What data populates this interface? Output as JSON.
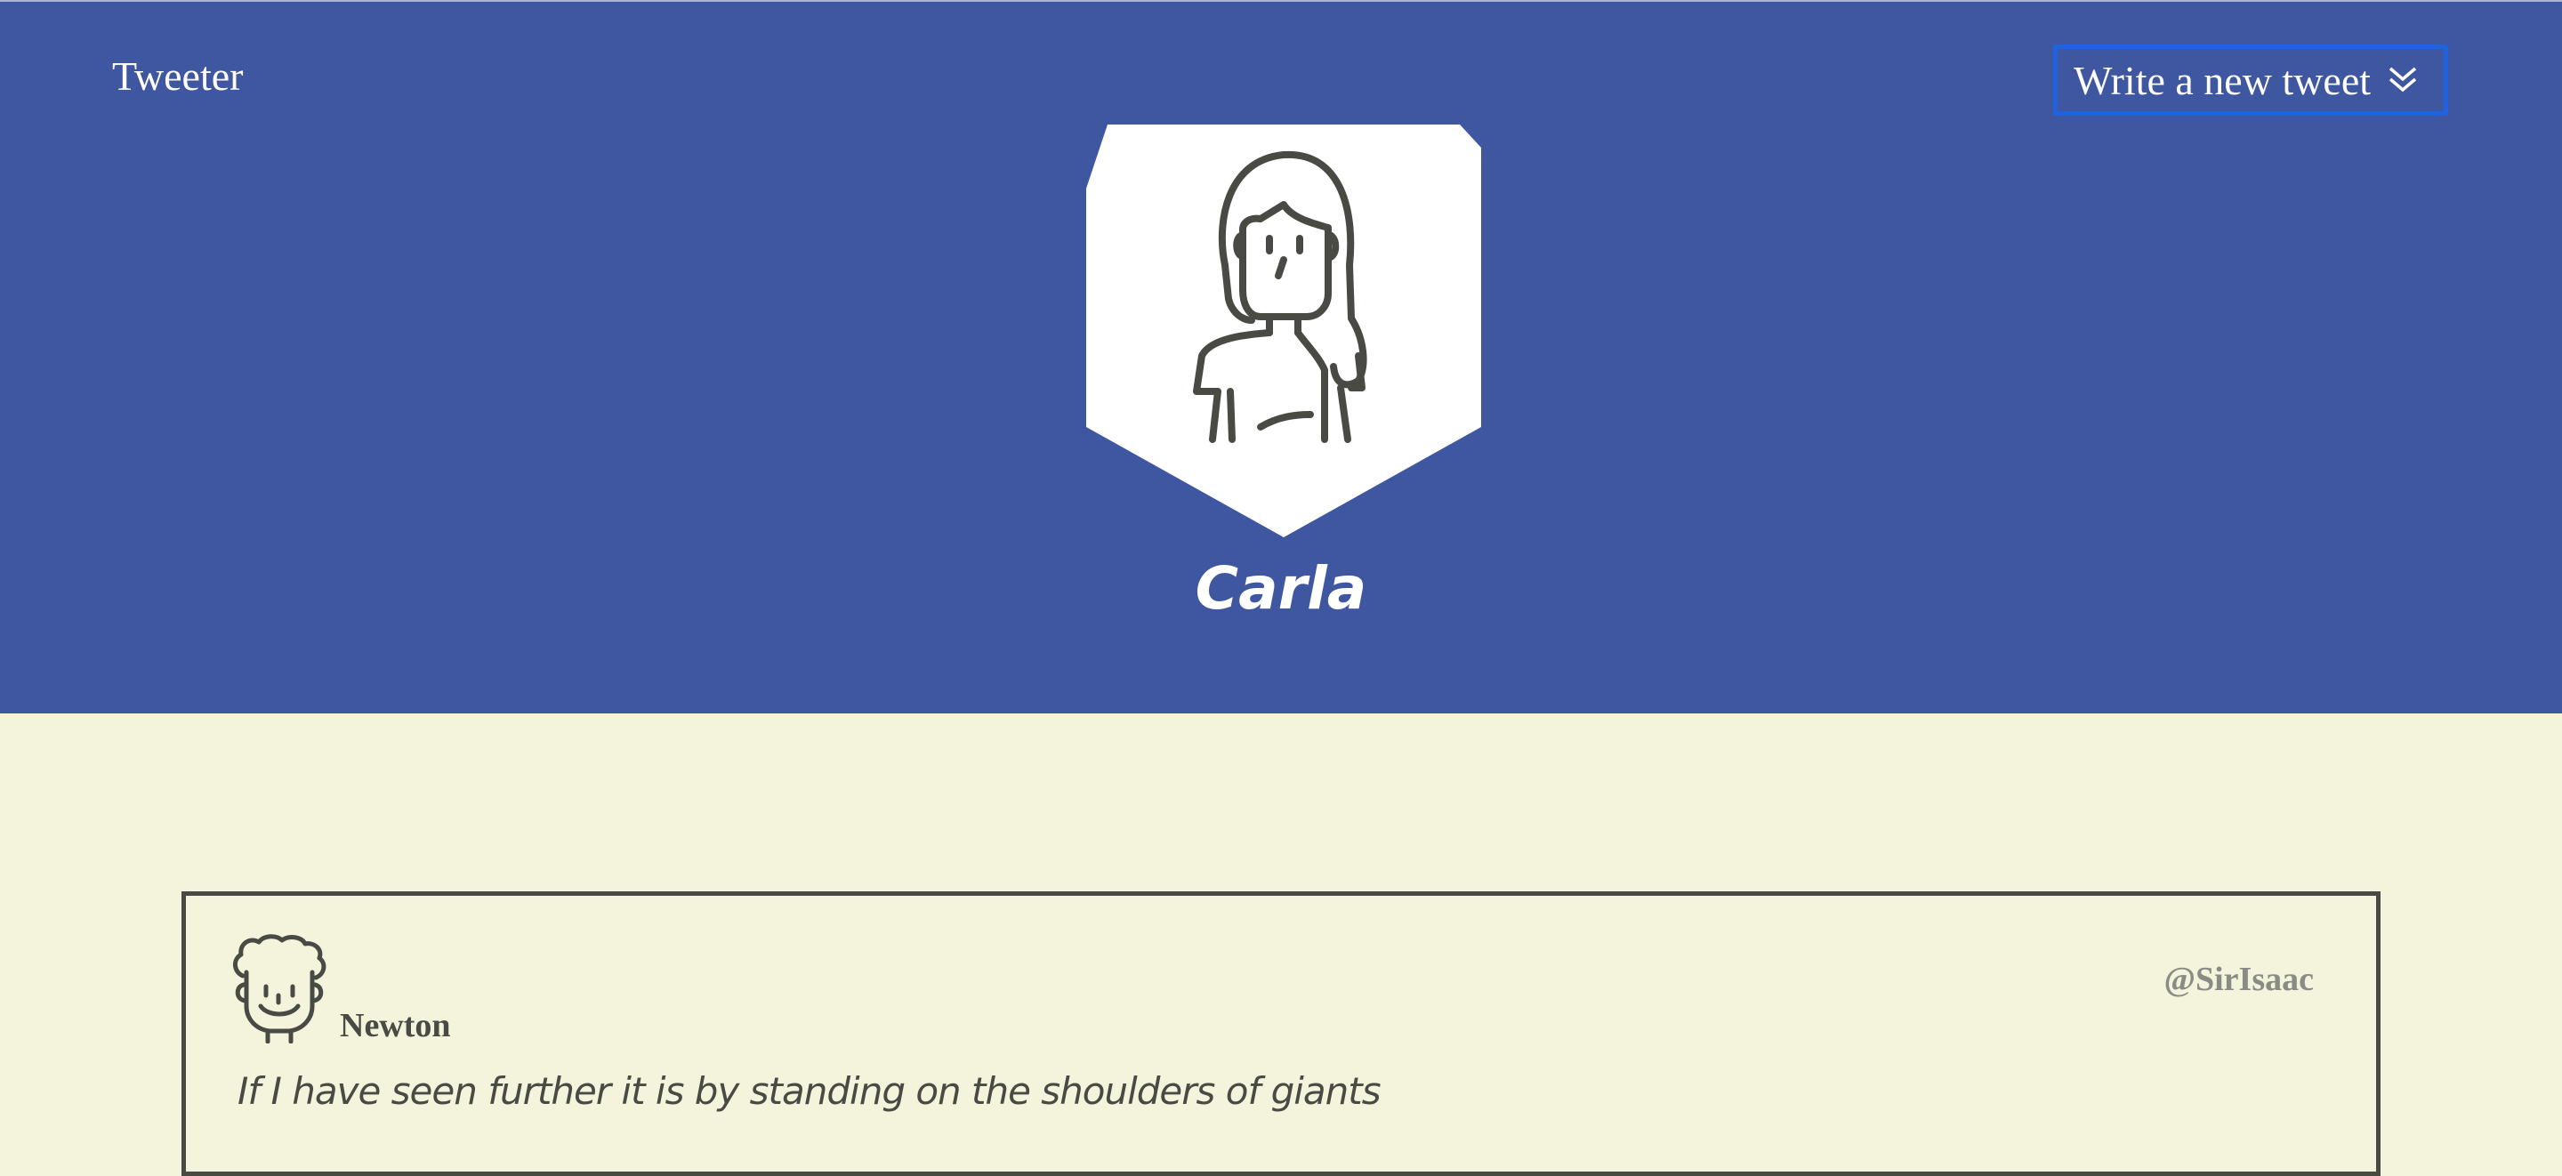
{
  "nav": {
    "brand": "Tweeter",
    "compose_label": "Write a new tweet",
    "compose_icon": "double-chevron-down-icon"
  },
  "profile": {
    "name": "Carla",
    "avatar_icon": "female-avatar-icon"
  },
  "tweets": [
    {
      "name": "Newton",
      "handle": "@SirIsaac",
      "content": "If I have seen further it is by standing on the shoulders of giants",
      "avatar_icon": "male-avatar-icon"
    }
  ],
  "colors": {
    "header_bg": "#3f56a0",
    "page_bg": "#f4f4dc",
    "text_dark": "#4a4a45",
    "handle_gray": "#8b8b86",
    "button_border": "#1f63e0"
  }
}
